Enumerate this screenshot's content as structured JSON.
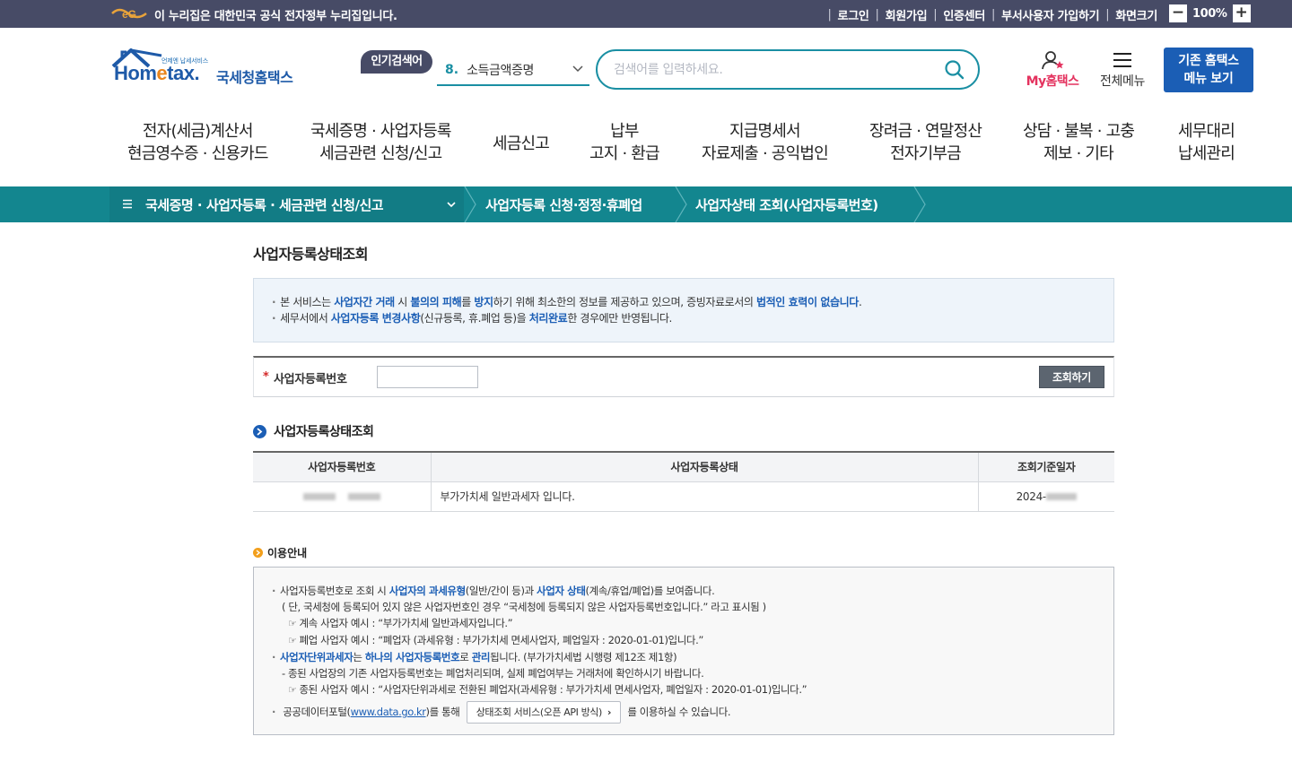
{
  "topbar": {
    "gov_notice": "이 누리집은 대한민국 공식 전자정부 누리집입니다.",
    "links": [
      "로그인",
      "회원가입",
      "인증센터",
      "부서사용자 가입하기",
      "화면크기"
    ],
    "zoom_minus": "−",
    "zoom_value": "100%",
    "zoom_plus": "+"
  },
  "brand": {
    "tagline": "언제엔 납세서비스",
    "word_a": "Hom",
    "word_e": "e",
    "word_b": "tax.",
    "name": "국세청홈택스"
  },
  "search": {
    "popular_tag": "인기검색어",
    "popular_rank": "8.",
    "popular_term": "소득금액증명",
    "placeholder": "검색어를 입력하세요."
  },
  "header_actions": {
    "my_hometax_a": "My",
    "my_hometax_b": "홈택스",
    "all_menu": "전체메뉴",
    "old_menu_line1": "기존 홈택스",
    "old_menu_line2": "메뉴 보기"
  },
  "nav": [
    {
      "line1": "전자(세금)계산서",
      "line2": "현금영수증 · 신용카드"
    },
    {
      "line1": "국세증명 · 사업자등록",
      "line2": "세금관련 신청/신고"
    },
    {
      "line1": "세금신고",
      "line2": ""
    },
    {
      "line1": "납부",
      "line2": "고지 · 환급"
    },
    {
      "line1": "지급명세서",
      "line2": "자료제출 · 공익법인"
    },
    {
      "line1": "장려금 · 연말정산",
      "line2": "전자기부금"
    },
    {
      "line1": "상담 · 불복 · 고충",
      "line2": "제보 · 기타"
    },
    {
      "line1": "세무대리",
      "line2": "납세관리"
    }
  ],
  "breadcrumb": {
    "level1": "국세증명 · 사업자등록 · 세금관련 신청/신고",
    "level2": "사업자등록 신청·정정·휴폐업",
    "level3": "사업자상태 조회(사업자등록번호)"
  },
  "page": {
    "title": "사업자등록상태조회",
    "notice": {
      "l1_a": "본 서비스는 ",
      "l1_b": "사업자간 거래",
      "l1_c": " 시 ",
      "l1_d": "불의의 피해",
      "l1_e": "를 ",
      "l1_f": "방지",
      "l1_g": "하기 위해 최소한의 정보를 제공하고 있으며, 증빙자료로서의 ",
      "l1_h": "법적인 효력이 없습니다",
      "l1_i": ".",
      "l2_a": "세무서에서 ",
      "l2_b": "사업자등록 변경사항",
      "l2_c": "(신규등록, 휴.폐업 등)을 ",
      "l2_d": "처리완료",
      "l2_e": "한 경우에만 반영됩니다."
    },
    "form": {
      "required_mark": "*",
      "label": "사업자등록번호",
      "input_value": "",
      "button": "조회하기"
    },
    "result_section_title": "사업자등록상태조회",
    "result_table": {
      "headers": [
        "사업자등록번호",
        "사업자등록상태",
        "조회기준일자"
      ],
      "rows": [
        {
          "status": "부가가치세 일반과세자 입니다.",
          "date_prefix": "2024-"
        }
      ]
    },
    "guide": {
      "title": "이용안내",
      "l1_a": "사업자등록번호로 조회 시 ",
      "l1_b": "사업자의 과세유형",
      "l1_c": "(일반/간이 등)과 ",
      "l1_d": "사업자 상태",
      "l1_e": "(계속/휴업/폐업)를 보여줍니다.",
      "l2": "( 단, 국세청에 등록되어 있지 않은 사업자번호인 경우 “국세청에 등록되지 않은 사업자등록번호입니다.” 라고 표시됨 )",
      "l3": "계속 사업자 예시 : “부가가치세 일반과세자입니다.”",
      "l4": "폐업 사업자 예시 : “폐업자 (과세유형 : 부가가치세 면세사업자, 폐업일자 : 2020-01-01)입니다.”",
      "l5_a": "사업자단위과세자",
      "l5_b": "는 ",
      "l5_c": "하나의 사업자등록번호",
      "l5_d": "로 ",
      "l5_e": "관리",
      "l5_f": "됩니다. (부가가치세법 시행령 제12조 제1항)",
      "l6": "- 종된 사업장의 기존 사업자등록번호는 폐업처리되며, 실제 폐업여부는 거래처에 확인하시기 바랍니다.",
      "l7": "종된 사업자 예시 : “사업자단위과세로 전환된 폐업자(과세유형 : 부가가치세 면세사업자, 폐업일자 : 2020-01-01)입니다.”",
      "l8_a": "공공데이터포털(",
      "l8_link": "www.data.go.kr",
      "l8_b": ")를 통해",
      "api_button": "상태조회 서비스(오픈 API 방식)",
      "l8_c": "를 이용하실 수 있습니다."
    }
  },
  "colors": {
    "topbar": "#474b66",
    "teal": "#13868f",
    "brand_blue": "#1b5eb5",
    "accent_pink": "#e4335f"
  }
}
